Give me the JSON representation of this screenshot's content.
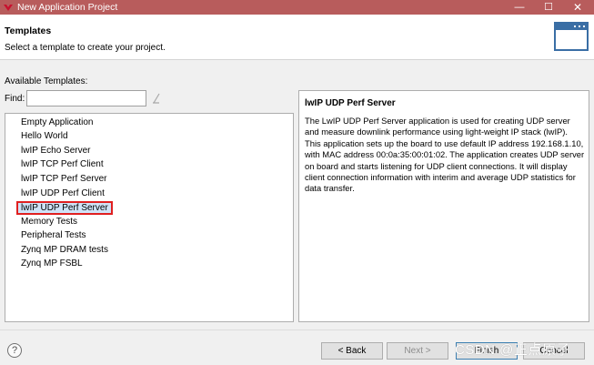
{
  "window": {
    "title": "New Application Project",
    "controls": {
      "minimize": "—",
      "maximize": "☐",
      "close": "✕"
    }
  },
  "header": {
    "title": "Templates",
    "subtitle": "Select a template to create your project."
  },
  "available_label": "Available Templates:",
  "find": {
    "label": "Find:",
    "value": "",
    "placeholder": ""
  },
  "templates": [
    "Empty Application",
    "Hello World",
    "lwIP Echo Server",
    "lwIP TCP Perf Client",
    "lwIP TCP Perf Server",
    "lwIP UDP Perf Client",
    "lwIP UDP Perf Server",
    "Memory Tests",
    "Peripheral Tests",
    "Zynq MP DRAM tests",
    "Zynq MP FSBL"
  ],
  "selected_template": "lwIP UDP Perf Server",
  "description": {
    "title": "lwIP UDP Perf Server",
    "body": "The LwIP UDP Perf Server application is used for creating UDP server and measure downlink performance using light-weight IP stack (lwIP). This application sets up the board to use default IP address 192.168.1.10, with MAC address 00:0a:35:00:01:02. The application creates UDP server on board and starts listening for UDP client connections. It will display client connection information with interim and average UDP statistics for data transfer."
  },
  "buttons": {
    "back": "< Back",
    "next": "Next >",
    "finish": "Finish",
    "cancel": "Cancel"
  },
  "watermark": "CSDN @正点原子",
  "colors": {
    "titlebar": "#b85c5c",
    "selection_outline": "#e02020",
    "selection_fill": "#cfe3f7",
    "banner_icon": "#3a6ea5"
  }
}
